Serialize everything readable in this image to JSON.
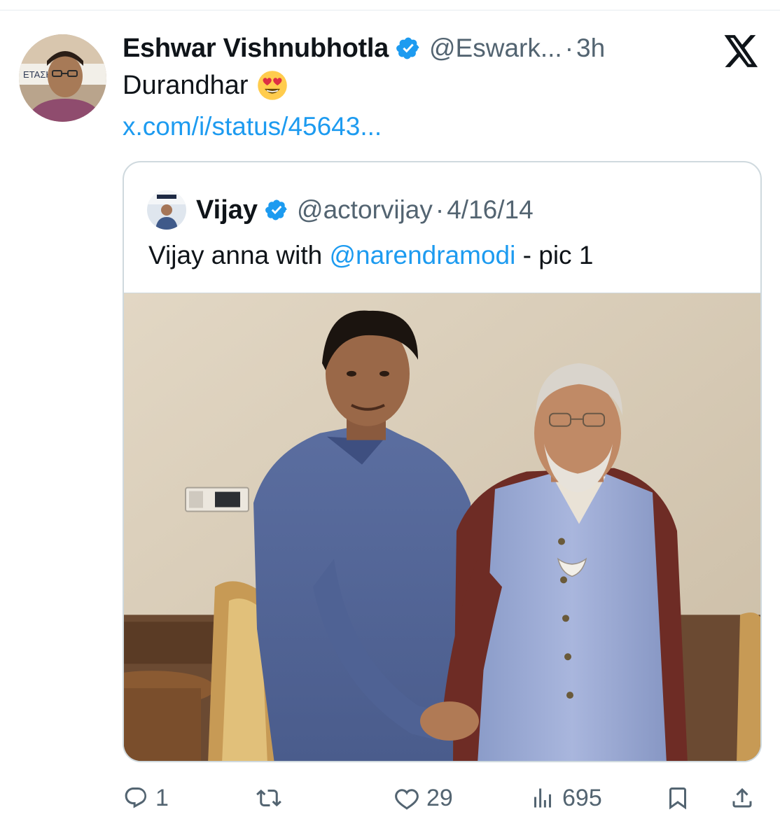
{
  "tweet": {
    "author_name": "Eshwar Vishnubhotla",
    "author_handle": "@Eswark...",
    "separator": "·",
    "time": "3h",
    "text": "Durandhar",
    "link": "x.com/i/status/45643...",
    "avatar_sign_text": "ΕΤΑΣΗ"
  },
  "quoted": {
    "author_name": "Vijay",
    "author_handle": "@actorvijay",
    "separator": "·",
    "date": "4/16/14",
    "text_before": "Vijay anna with ",
    "mention": "@narendramodi",
    "text_after": " - pic 1"
  },
  "actions": {
    "replies": "1",
    "retweets": "",
    "likes": "29",
    "views": "695"
  },
  "colors": {
    "accent": "#1d9bf0",
    "secondary_text": "#536471",
    "border": "#cfd9de"
  },
  "icons": [
    "verified-badge-icon",
    "x-logo-icon",
    "heart-eyes-emoji-icon",
    "reply-icon",
    "retweet-icon",
    "like-icon",
    "views-icon",
    "bookmark-icon",
    "share-icon"
  ]
}
